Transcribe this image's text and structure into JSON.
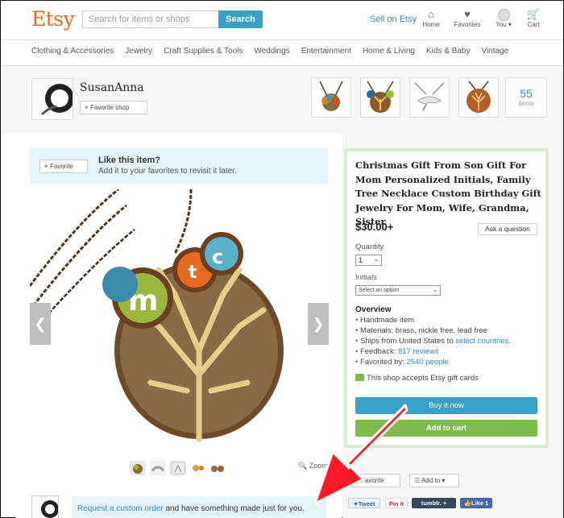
{
  "header": {
    "logo": "Etsy",
    "search_placeholder": "Search for items or shops",
    "search_button": "Search",
    "sell_link": "Sell on Etsy",
    "nav": [
      {
        "label": "Home",
        "icon": "home-icon"
      },
      {
        "label": "Favorites",
        "icon": "heart-icon"
      },
      {
        "label": "You ▾",
        "icon": "user-icon"
      },
      {
        "label": "Cart",
        "icon": "cart-icon"
      }
    ]
  },
  "categories": [
    "Clothing & Accessories",
    "Jewelry",
    "Craft Supplies & Tools",
    "Weddings",
    "Entertainment",
    "Home & Living",
    "Kids & Baby",
    "Vintage"
  ],
  "shop": {
    "name": "SusanAnna",
    "favorite_shop": "Favorite shop",
    "item_count": "55",
    "items_label": "items"
  },
  "like_box": {
    "favorite_button": "Favorite",
    "title": "Like this item?",
    "subtitle": "Add it to your favorites to revisit it later."
  },
  "gallery": {
    "zoom_label": "Zoom"
  },
  "custom_order": {
    "link": "Request a custom order",
    "text": " and have something made just for you."
  },
  "product": {
    "title": "Christmas Gift From Son Gift For Mom Personalized Initials, Family Tree Necklace Custom Birthday Gift Jewelry For Mom, Wife, Grandma, Sister",
    "price": "$30.00+",
    "ask_question": "Ask a question",
    "quantity_label": "Quantity",
    "quantity_value": "1",
    "initials_label": "Initials",
    "initials_placeholder": "Select an option",
    "overview_title": "Overview",
    "overview": {
      "handmade": "Handmade item",
      "materials": "Materials: brass, nickle free, lead free",
      "ships_prefix": "Ships from United States to ",
      "ships_link": "select countries",
      "ships_suffix": ".",
      "feedback_prefix": "Feedback: ",
      "feedback_link": "817 reviews",
      "favorited_prefix": "Favorited by: ",
      "favorited_link": "2540 people"
    },
    "gift_cards": "This shop accepts Etsy gift cards",
    "buy_now": "Buy it now",
    "add_to_cart": "Add to cart"
  },
  "actions": {
    "favorite": "Favorite",
    "add_to": "Add to ▾",
    "tweet": "Tweet",
    "pinit": "Pin it",
    "tumblr": "tumblr.",
    "fb_like": "Like 1"
  },
  "colors": {
    "brand": "#e9681c",
    "link": "#2d8bbd",
    "buy": "#3aa0c8",
    "cart": "#7cbb4c",
    "arrow": "#ff1a2a"
  }
}
